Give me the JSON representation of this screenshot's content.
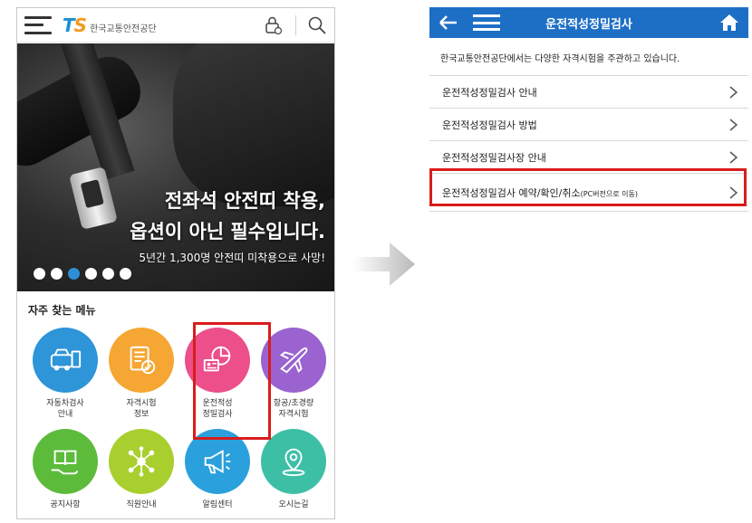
{
  "left": {
    "header": {
      "logo_mark_1": "T",
      "logo_mark_2": "S",
      "logo_text": "한국교통안전공단",
      "icons": [
        "menu-icon",
        "login-icon",
        "search-icon"
      ]
    },
    "banner": {
      "headline_1": "전좌석 안전띠 착용,",
      "headline_2": "옵션이 아닌 필수입니다.",
      "subline": "5년간 1,300명 안전띠 미착용으로 사망!",
      "slide_count": 6,
      "active_slide": 3
    },
    "favorites": {
      "title": "자주 찾는 메뉴",
      "items": [
        {
          "label": "자동차검사\n안내",
          "color": "#2d95d8",
          "icon": "car-inspection-icon"
        },
        {
          "label": "자격시험\n정보",
          "color": "#f5a633",
          "icon": "exam-document-icon"
        },
        {
          "label": "운전적성\n정밀검사",
          "color": "#ec4f8a",
          "icon": "aptitude-test-icon"
        },
        {
          "label": "항공/초경량\n자격시험",
          "color": "#9a63cf",
          "icon": "airplane-icon"
        },
        {
          "label": "공지사항",
          "color": "#5dbb3c",
          "icon": "book-hand-icon"
        },
        {
          "label": "직원안내",
          "color": "#a8cf2e",
          "icon": "network-icon"
        },
        {
          "label": "알림센터",
          "color": "#2aa0dc",
          "icon": "megaphone-icon"
        },
        {
          "label": "오시는길",
          "color": "#3dbfa6",
          "icon": "location-pin-icon"
        }
      ]
    }
  },
  "right": {
    "header": {
      "title": "운전적성정밀검사",
      "icons": [
        "back-arrow-icon",
        "menu-icon",
        "home-icon"
      ]
    },
    "intro": "한국교통안전공단에서는 다양한 자격시험을 주관하고 있습니다.",
    "menu": [
      {
        "label": "운전적성정밀검사 안내",
        "note": ""
      },
      {
        "label": "운전적성정밀검사 방법",
        "note": ""
      },
      {
        "label": "운전적성정밀검사장 안내",
        "note": ""
      },
      {
        "label": "운전적성정밀검사 예약/확인/취소",
        "note": "(PC버전으로 이동)"
      }
    ]
  },
  "colors": {
    "header_blue": "#1d6fc6",
    "highlight_red": "#d91c1c",
    "ts_blue": "#1a8fd0",
    "ts_orange": "#f29a1f"
  }
}
